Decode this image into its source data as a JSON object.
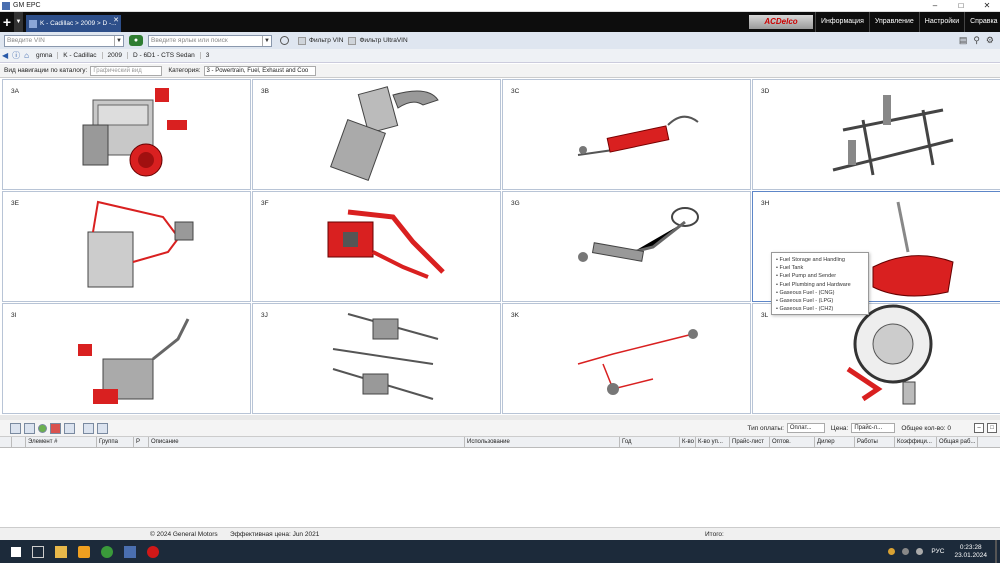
{
  "window": {
    "title": "GM EPC"
  },
  "tab": {
    "label": "K - Cadillac > 2009 > D -..."
  },
  "acdelco": {
    "label": "ACDelco"
  },
  "menu": [
    "Информация",
    "Управление",
    "Настройки",
    "Справка"
  ],
  "vin": {
    "placeholder": "Введите VIN",
    "search_placeholder": "Введите ярлык или поиск",
    "filter_vin": "Фильтр VIN",
    "filter_ultravin": "Фильтр UltraVIN"
  },
  "breadcrumb": [
    "gmna",
    "K - Cadillac",
    "2009",
    "D - 6D1 - CTS Sedan",
    "3"
  ],
  "nav": {
    "view_label": "Вид навигации по каталогу:",
    "view_value": "Графический вид",
    "category_label": "Категория:",
    "category_value": "3 - Powertrain, Fuel, Exhaust and Coo"
  },
  "cells": [
    "3A",
    "3B",
    "3C",
    "3D",
    "3E",
    "3F",
    "3G",
    "3H",
    "3I",
    "3J",
    "3K",
    "3L"
  ],
  "tooltip": [
    "Fuel Storage and Handling",
    "Fuel Tank",
    "Fuel Pump and Sender",
    "Fuel Plumbing and Hardware",
    "Gaseous Fuel - (CNG)",
    "Gaseous Fuel - (LPG)",
    "Gaseous Fuel - (CH2)"
  ],
  "bottom_toolbar": {
    "payment_label": "Тип оплаты:",
    "payment_value": "Оплат...",
    "price_label": "Цена:",
    "price_value": "Прайс-л...",
    "total_qty": "Общее кол-во: 0"
  },
  "columns": [
    "Элемент #",
    "Группа",
    "Р",
    "Описание",
    "Использование",
    "Год",
    "К-во",
    "К-во уп...",
    "Прайс-лист",
    "Оптов.",
    "Дилер",
    "Работы",
    "Коэффици...",
    "Общая раб..."
  ],
  "status": {
    "copyright": "© 2024 General Motors",
    "effective": "Эффективная цена: Jun 2021",
    "total": "Итого:"
  },
  "taskbar": {
    "lang": "РУС",
    "time": "0:23:28",
    "date": "23.01.2024"
  },
  "colors": {
    "accent": "#2e4f8a",
    "parts_red": "#d92020"
  }
}
